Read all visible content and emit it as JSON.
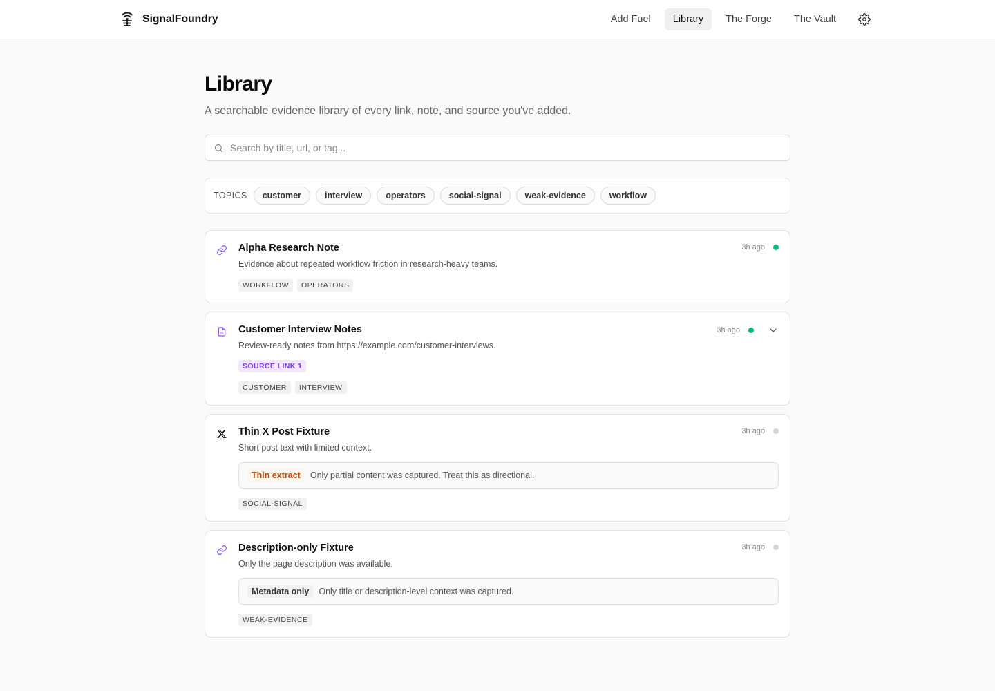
{
  "app": {
    "name": "SignalFoundry"
  },
  "nav": {
    "items": [
      {
        "label": "Add Fuel",
        "active": false
      },
      {
        "label": "Library",
        "active": true
      },
      {
        "label": "The Forge",
        "active": false
      },
      {
        "label": "The Vault",
        "active": false
      }
    ],
    "settings_icon": "gear-icon"
  },
  "page": {
    "title": "Library",
    "subtitle": "A searchable evidence library of every link, note, and source you've added."
  },
  "search": {
    "placeholder": "Search by title, url, or tag...",
    "value": ""
  },
  "topics": {
    "label": "TOPICS",
    "items": [
      "customer",
      "interview",
      "operators",
      "social-signal",
      "weak-evidence",
      "workflow"
    ]
  },
  "cards": [
    {
      "icon": "link-icon",
      "title": "Alpha Research Note",
      "description": "Evidence about repeated workflow friction in research-heavy teams.",
      "time": "3h ago",
      "status": "green",
      "tags": [
        "WORKFLOW",
        "OPERATORS"
      ]
    },
    {
      "icon": "document-icon",
      "title": "Customer Interview Notes",
      "description": "Review-ready notes from https://example.com/customer-interviews.",
      "time": "3h ago",
      "status": "green",
      "source_badge": "SOURCE LINK 1",
      "tags": [
        "CUSTOMER",
        "INTERVIEW"
      ]
    },
    {
      "icon": "x-logo-icon",
      "title": "Thin X Post Fixture",
      "description": "Short post text with limited context.",
      "time": "3h ago",
      "status": "gray",
      "notice": {
        "label": "Thin extract",
        "text": "Only partial content was captured. Treat this as directional."
      },
      "tags": [
        "SOCIAL-SIGNAL"
      ]
    },
    {
      "icon": "link-icon",
      "title": "Description-only Fixture",
      "description": "Only the page description was available.",
      "time": "3h ago",
      "status": "gray",
      "notice": {
        "label": "Metadata only",
        "text": "Only title or description-level context was captured."
      },
      "tags": [
        "WEAK-EVIDENCE"
      ]
    }
  ],
  "colors": {
    "accent": "#7c3aed",
    "status_ok": "#10b981",
    "status_idle": "#d4d4d4",
    "warning": "#c2410c"
  }
}
